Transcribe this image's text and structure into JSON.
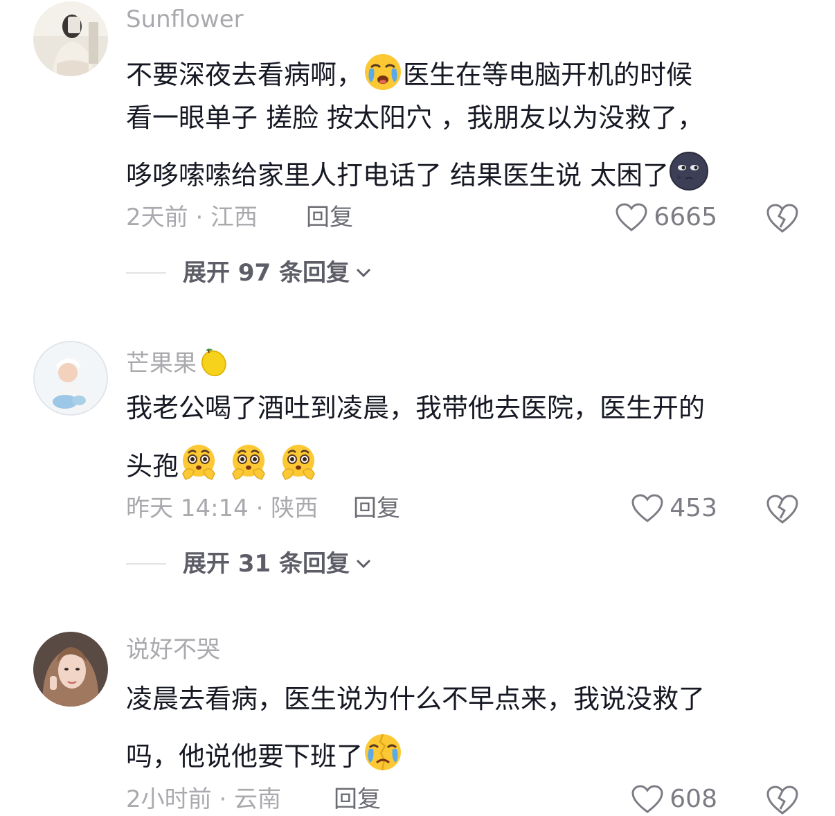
{
  "comments": [
    {
      "username": "Sunflower",
      "lines": [
        {
          "before": "不要深夜去看病啊，",
          "emoji": "crying-face-emoji",
          "after": "医生在等电脑开机的时候"
        },
        {
          "before": "看一眼单子 搓脸 按太阳穴 ，我朋友以为没救了，",
          "emoji": "",
          "after": ""
        },
        {
          "before": "哆哆嗦嗦给家里人打电话了 结果医生说 太困了",
          "emoji": "new-moon-face-emoji",
          "after": ""
        }
      ],
      "time_location": "2天前 · 江西",
      "reply_label": "回复",
      "likes": "6665",
      "expand_label": "展开 97 条回复"
    },
    {
      "username": "芒果果",
      "username_emoji": "lemon-emoji",
      "lines": [
        {
          "before": "我老公喝了酒吐到凌晨，我带他去医院，医生开的",
          "emoji": "",
          "after": ""
        },
        {
          "before": "头孢",
          "emoji": "worried-face-emoji",
          "after": ""
        }
      ],
      "time_location": "昨天 14:14 · 陕西",
      "reply_label": "回复",
      "likes": "453",
      "expand_label": "展开 31 条回复"
    },
    {
      "username": "说好不哭",
      "lines": [
        {
          "before": "凌晨去看病，医生说为什么不早点来，我说没救了",
          "emoji": "",
          "after": ""
        },
        {
          "before": "吗，他说他要下班了",
          "emoji": "broken-crying-emoji",
          "after": ""
        }
      ],
      "time_location": "2小时前 · 云南",
      "reply_label": "回复",
      "likes": "608"
    }
  ],
  "colors": {
    "text": "#161823",
    "meta": "#a9a9ae",
    "emoji_yellow": "#fcc934",
    "tear_blue": "#5aa9e8"
  }
}
